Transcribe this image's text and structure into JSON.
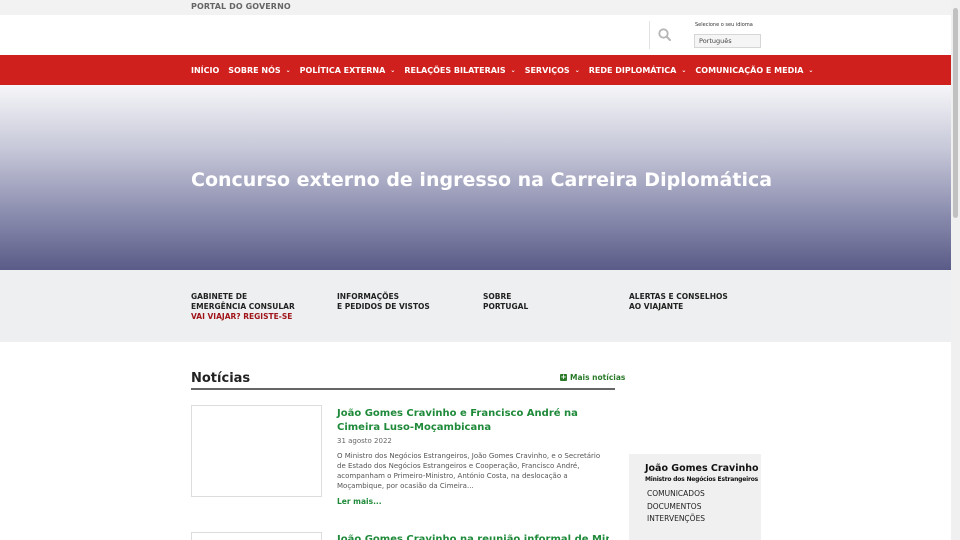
{
  "gov_bar": {
    "label": "PORTAL DO GOVERNO"
  },
  "header": {
    "search_icon": "search-icon",
    "language_label": "Selecione o seu idioma",
    "language_value": "Português"
  },
  "nav": {
    "items": [
      {
        "label": "INÍCIO",
        "has_dropdown": false
      },
      {
        "label": "SOBRE NÓS",
        "has_dropdown": true
      },
      {
        "label": "POLÍTICA EXTERNA",
        "has_dropdown": true
      },
      {
        "label": "RELAÇÕES BILATERAIS",
        "has_dropdown": true
      },
      {
        "label": "SERVIÇOS",
        "has_dropdown": true
      },
      {
        "label": "REDE DIPLOMÁTICA",
        "has_dropdown": true
      },
      {
        "label": "COMUNICAÇÃO E MEDIA",
        "has_dropdown": true
      }
    ],
    "chevron": "⌄"
  },
  "hero": {
    "title": "Concurso externo de ingresso na Carreira Diplomática"
  },
  "quick_links": [
    {
      "line1": "GABINETE DE",
      "line2": "EMERGÊNCIA CONSULAR",
      "line3": "VAI VIAJAR? REGISTE-SE"
    },
    {
      "line1": "INFORMAÇÕES",
      "line2": "E PEDIDOS DE VISTOS",
      "line3": ""
    },
    {
      "line1": "SOBRE",
      "line2": "PORTUGAL",
      "line3": ""
    },
    {
      "line1": "ALERTAS E CONSELHOS",
      "line2": "AO VIAJANTE",
      "line3": ""
    }
  ],
  "news": {
    "title": "Notícias",
    "more_label": "Mais notícias",
    "articles": [
      {
        "title": "João Gomes Cravinho e Francisco André na Cimeira Luso-Moçambicana",
        "date": "31 agosto 2022",
        "excerpt": "O Ministro dos Negócios Estrangeiros, João Gomes Cravinho, e o Secretário de Estado dos Negócios Estrangeiros e Cooperação, Francisco André, acompanham o Primeiro-Ministro, António Costa, na deslocação a Moçambique, por ocasião da Cimeira...",
        "read_more": "Ler mais..."
      },
      {
        "title": "João Gomes Cravinho na reunião informal de Ministros dos"
      }
    ]
  },
  "minister": {
    "name": "João Gomes Cravinho",
    "role": "Ministro dos Negócios Estrangeiros",
    "links": [
      "COMUNICADOS",
      "DOCUMENTOS",
      "INTERVENÇÕES"
    ]
  },
  "colors": {
    "nav_red": "#d0201d",
    "link_green": "#1f8a3a",
    "accent_dark_red": "#a0141a"
  }
}
